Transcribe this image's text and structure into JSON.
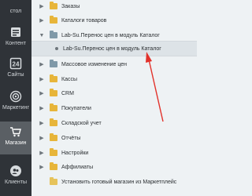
{
  "sidebar": {
    "items": [
      {
        "label": "стол",
        "icon": "desktop-icon"
      },
      {
        "label": "Контент",
        "icon": "content-icon"
      },
      {
        "label": "Сайты",
        "icon": "sites-icon"
      },
      {
        "label": "Маркетинг",
        "icon": "target-icon"
      },
      {
        "label": "Магазин",
        "icon": "cart-icon",
        "active": true
      },
      {
        "label": "Клиенты",
        "icon": "clients-icon"
      }
    ]
  },
  "tree": {
    "items": [
      {
        "label": "Заказы",
        "icon": "folder-icon"
      },
      {
        "label": "Каталоги товаров",
        "icon": "folder-icon"
      },
      {
        "label": "Lab-Su.Перенос цен в модуль Каталог",
        "icon": "folder-icon"
      },
      {
        "label": "Lab-Su.Перенос цен в модуль Каталог",
        "icon": "bullet-icon"
      },
      {
        "label": "Массовое изменение цен",
        "icon": "folder-icon"
      },
      {
        "label": "Кассы",
        "icon": "folder-icon"
      },
      {
        "label": "CRM",
        "icon": "folder-icon"
      },
      {
        "label": "Покупатели",
        "icon": "folder-icon"
      },
      {
        "label": "Складской учет",
        "icon": "folder-icon"
      },
      {
        "label": "Отчёты",
        "icon": "folder-icon"
      },
      {
        "label": "Настройки",
        "icon": "folder-icon"
      },
      {
        "label": "Аффилиаты",
        "icon": "folder-icon"
      },
      {
        "label": "Установить готовый магазин из Маркетплейс",
        "icon": "folder-icon"
      }
    ]
  },
  "colors": {
    "sidebar_bg": "#2f3338",
    "sidebar_active": "#5a5f64",
    "panel_bg": "#eef2f4",
    "selected_row": "#dde3e7",
    "annotation_arrow": "#e2322b"
  }
}
